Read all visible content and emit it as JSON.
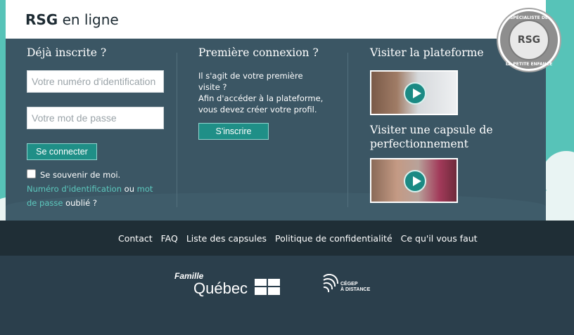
{
  "brand": {
    "logo_bold": "RSG",
    "logo_rest": " en ligne"
  },
  "badge": {
    "center": "RSG",
    "ring_top": "SPÉCIALISTE DE",
    "ring_bottom": "LA PETITE ENFANCE"
  },
  "login": {
    "heading": "Déjà inscrite ?",
    "id_placeholder": "Votre numéro d'identification",
    "password_placeholder": "Votre mot de passe",
    "submit_label": "Se connecter",
    "remember_label": "Se souvenir de moi.",
    "forgot_link_1": "Numéro d'identification",
    "forgot_or": " ou ",
    "forgot_link_2a": "mot",
    "forgot_link_2b": "de passe",
    "forgot_suffix": " oublié ?"
  },
  "first_login": {
    "heading": "Première connexion ?",
    "line1": "Il s'agit de votre première",
    "line2": "visite ?",
    "line3": "Afin d'accéder à la plateforme,",
    "line4": "vous devez créer votre profil.",
    "signup_label": "S'inscrire"
  },
  "visit": {
    "heading": "Visiter la plateforme",
    "capsule_heading_1": "Visiter une capsule de",
    "capsule_heading_2": "perfectionnement"
  },
  "footer_nav": {
    "links": [
      "Contact",
      "FAQ",
      "Liste des capsules",
      "Politique de confidentialité",
      "Ce qu'il vous faut"
    ]
  },
  "footer_logos": {
    "famille": "Famille",
    "quebec": "Québec",
    "cegep_line1": "CÉGEP",
    "cegep_line2": "À DISTANCE"
  },
  "colors": {
    "teal": "#57c3b8",
    "panel": "#3b5664",
    "button": "#1f8f87",
    "link": "#5cc8bd",
    "footer": "#1f2e36"
  },
  "icons": [
    "play-icon",
    "checkbox",
    "quebec-flag-icon",
    "cegep-logo-icon"
  ]
}
